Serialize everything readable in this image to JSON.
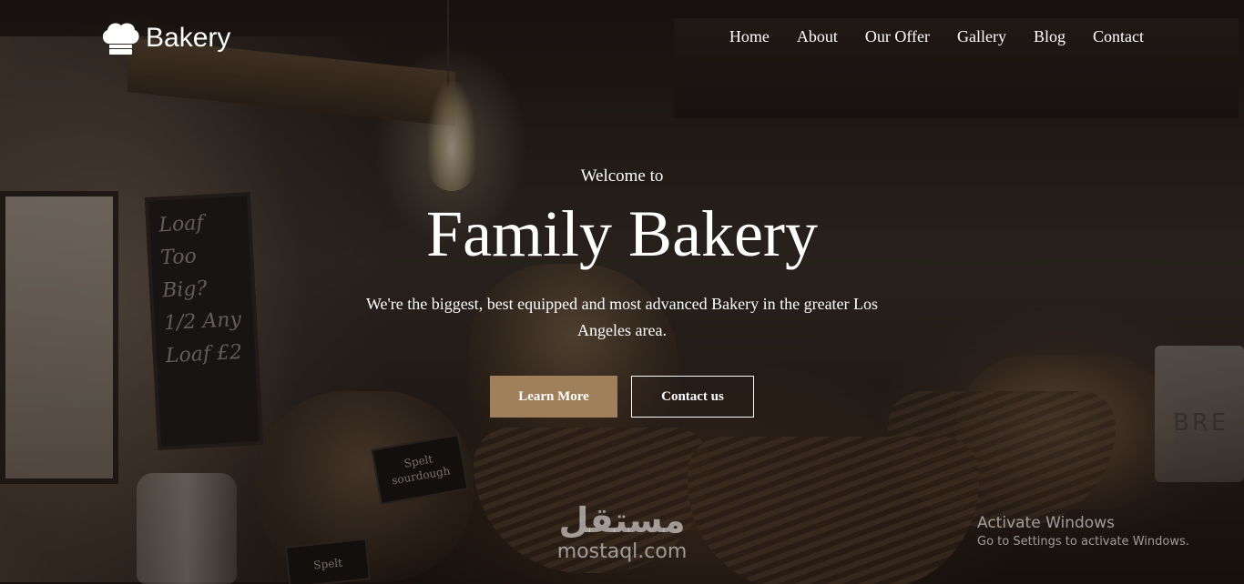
{
  "header": {
    "logo": {
      "icon": "chef-hat-icon",
      "text": "Bakery"
    },
    "nav": [
      {
        "label": "Home"
      },
      {
        "label": "About"
      },
      {
        "label": "Our Offer"
      },
      {
        "label": "Gallery"
      },
      {
        "label": "Blog"
      },
      {
        "label": "Contact"
      }
    ]
  },
  "hero": {
    "welcome": "Welcome to",
    "title": "Family Bakery",
    "subtitle": "We're the biggest, best equipped and most advanced Bakery in the greater Los Angeles area.",
    "primary_button": "Learn More",
    "secondary_button": "Contact us",
    "background_photo": {
      "chalkboard_text": "Loaf Too Big? 1/2 Any Loaf £2",
      "sign_1": "Spelt sourdough",
      "sign_2": "Spelt",
      "bin_text": "BRE"
    }
  },
  "watermark": {
    "arabic": "مستقل",
    "latin": "mostaql.com"
  },
  "os_notice": {
    "title": "Activate Windows",
    "subtitle": "Go to Settings to activate Windows."
  },
  "colors": {
    "primary_button": "#a0805a",
    "text": "#ffffff",
    "overlay": "#120c08"
  }
}
